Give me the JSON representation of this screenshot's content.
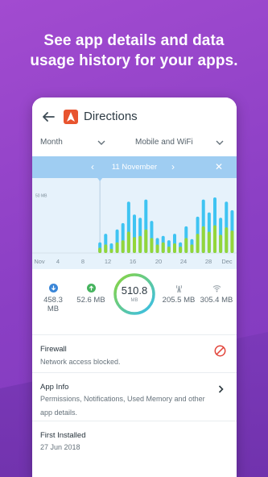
{
  "headline": {
    "line1": "See app details and data",
    "line2": "usage history for your apps."
  },
  "appbar": {
    "title": "Directions",
    "back_icon": "arrow-left-icon",
    "app_icon": "navigation-arrow-icon"
  },
  "filters": {
    "period": "Month",
    "network": "Mobile and WiFi"
  },
  "selection": {
    "date": "11 November",
    "prev": "‹",
    "next": "›",
    "close": "✕"
  },
  "chart_data": {
    "type": "bar",
    "ylabel_marker": "50 MB",
    "x_tick_labels": [
      "Nov",
      "4",
      "8",
      "12",
      "16",
      "20",
      "24",
      "28",
      "Dec"
    ],
    "colors": {
      "wifi": "#3fc4f2",
      "mobile": "#93d63a"
    },
    "bars": [
      {
        "wifi": 0,
        "mobile": 0
      },
      {
        "wifi": 0,
        "mobile": 0
      },
      {
        "wifi": 0,
        "mobile": 0
      },
      {
        "wifi": 0,
        "mobile": 0
      },
      {
        "wifi": 0,
        "mobile": 0
      },
      {
        "wifi": 0,
        "mobile": 0
      },
      {
        "wifi": 0,
        "mobile": 0
      },
      {
        "wifi": 0,
        "mobile": 0
      },
      {
        "wifi": 0,
        "mobile": 0
      },
      {
        "wifi": 0,
        "mobile": 0
      },
      {
        "wifi": 0,
        "mobile": 0
      },
      {
        "wifi": 10,
        "mobile": 5
      },
      {
        "wifi": 18,
        "mobile": 8
      },
      {
        "wifi": 9,
        "mobile": 4
      },
      {
        "wifi": 22,
        "mobile": 10
      },
      {
        "wifi": 28,
        "mobile": 12
      },
      {
        "wifi": 48,
        "mobile": 20
      },
      {
        "wifi": 36,
        "mobile": 15
      },
      {
        "wifi": 33,
        "mobile": 16
      },
      {
        "wifi": 50,
        "mobile": 22
      },
      {
        "wifi": 30,
        "mobile": 14
      },
      {
        "wifi": 14,
        "mobile": 8
      },
      {
        "wifi": 16,
        "mobile": 10
      },
      {
        "wifi": 12,
        "mobile": 6
      },
      {
        "wifi": 18,
        "mobile": 9
      },
      {
        "wifi": 10,
        "mobile": 6
      },
      {
        "wifi": 25,
        "mobile": 14
      },
      {
        "wifi": 13,
        "mobile": 8
      },
      {
        "wifi": 34,
        "mobile": 18
      },
      {
        "wifi": 50,
        "mobile": 25
      },
      {
        "wifi": 38,
        "mobile": 20
      },
      {
        "wifi": 52,
        "mobile": 26
      },
      {
        "wifi": 33,
        "mobile": 17
      },
      {
        "wifi": 48,
        "mobile": 24
      },
      {
        "wifi": 40,
        "mobile": 21
      }
    ],
    "selected_index": 11
  },
  "stats": [
    {
      "icon": "download-icon",
      "color": "#3a86d8",
      "value": "458.3 MB"
    },
    {
      "icon": "upload-icon",
      "color": "#46b45e",
      "value": "52.6 MB"
    },
    {
      "icon": "cellular-tower-icon",
      "color": "#9aa4ab",
      "value": "205.5 MB"
    },
    {
      "icon": "wifi-icon",
      "color": "#9aa4ab",
      "value": "305.4 MB"
    }
  ],
  "total": {
    "value": "510.8",
    "unit": "MB"
  },
  "firewall": {
    "title": "Firewall",
    "subtitle": "Network access blocked."
  },
  "app_info": {
    "title": "App Info",
    "subtitle": "Permissions, Notifications, Used Memory and other app details."
  },
  "first_installed": {
    "title": "First Installed",
    "value": "27 Jun 2018"
  }
}
